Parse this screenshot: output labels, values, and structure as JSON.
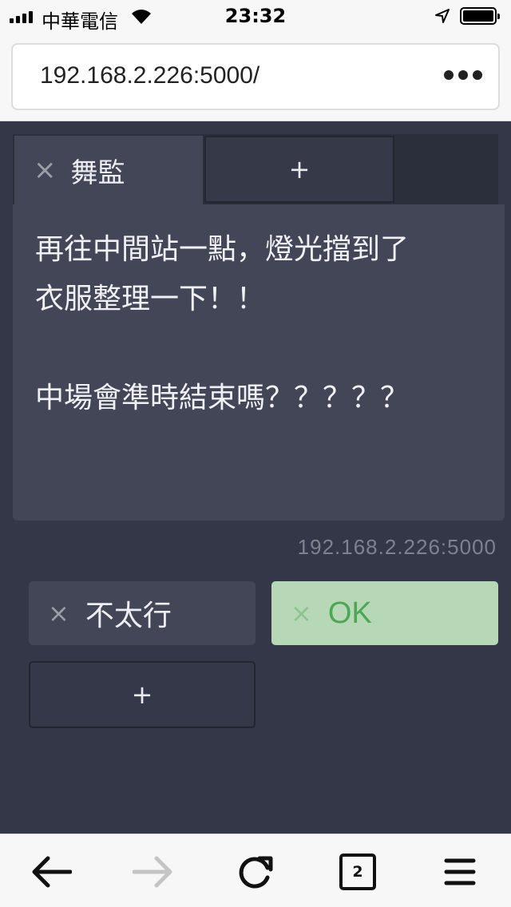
{
  "status_bar": {
    "carrier": "中華電信",
    "time": "23:32",
    "icons": [
      "signal-icon",
      "wifi-icon",
      "location-icon",
      "battery-icon"
    ]
  },
  "browser": {
    "url": "192.168.2.226:5000/",
    "tabs_count": "2"
  },
  "tabs": {
    "items": [
      {
        "label": "舞監",
        "close": "×"
      }
    ],
    "add_label": "+"
  },
  "message": {
    "lines": [
      "再往中間站一點，燈光擋到了",
      "衣服整理一下！！",
      "",
      "中場會準時結束嗎？？？？？"
    ]
  },
  "host": "192.168.2.226:5000",
  "options": {
    "items": [
      {
        "label": "不太行",
        "close": "×",
        "state": "default"
      },
      {
        "label": "OK",
        "close": "×",
        "state": "selected"
      }
    ],
    "add_label": "+"
  },
  "colors": {
    "background": "#333747",
    "panel": "#424656",
    "ok_bg": "#b6d8b7",
    "ok_text": "#4da653"
  }
}
